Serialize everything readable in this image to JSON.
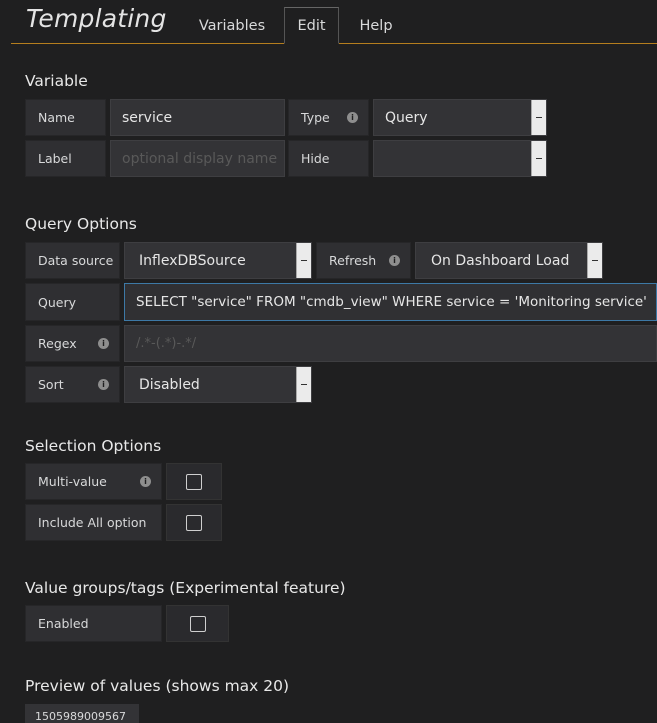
{
  "header": {
    "title": "Templating",
    "tabs": [
      {
        "label": "Variables"
      },
      {
        "label": "Edit"
      },
      {
        "label": "Help"
      }
    ]
  },
  "variable": {
    "section_title": "Variable",
    "name_label": "Name",
    "name_value": "service",
    "type_label": "Type",
    "type_value": "Query",
    "label_label": "Label",
    "label_placeholder": "optional display name",
    "hide_label": "Hide",
    "hide_value": ""
  },
  "query_options": {
    "section_title": "Query Options",
    "datasource_label": "Data source",
    "datasource_value": "InflexDBSource",
    "refresh_label": "Refresh",
    "refresh_value": "On Dashboard Load",
    "query_label": "Query",
    "query_value": "SELECT \"service\"  FROM \"cmdb_view\" WHERE service = 'Monitoring service'",
    "regex_label": "Regex",
    "regex_placeholder": "/.*-(.*)-.*/",
    "sort_label": "Sort",
    "sort_value": "Disabled"
  },
  "selection_options": {
    "section_title": "Selection Options",
    "multi_value_label": "Multi-value",
    "include_all_label": "Include All option"
  },
  "value_groups": {
    "section_title": "Value groups/tags (Experimental feature)",
    "enabled_label": "Enabled"
  },
  "preview": {
    "section_title": "Preview of values (shows max 20)",
    "values": [
      "1505989009567"
    ]
  },
  "icons": {
    "info": "info-icon",
    "dropdown": "dropdown-caret-icon",
    "checkbox": "checkbox-icon"
  },
  "colors": {
    "background": "#1f1f20",
    "accent_line": "#b57e1e",
    "focus_border": "#3d79a6"
  }
}
